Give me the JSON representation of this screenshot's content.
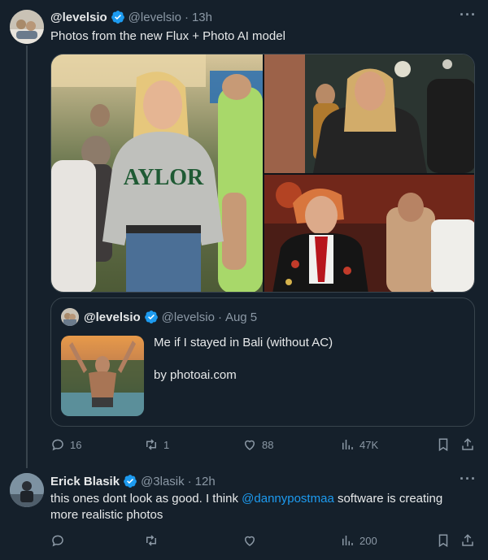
{
  "tweet": {
    "display_name": "@levelsio",
    "handle": "@levelsio",
    "separator": "·",
    "time": "13h",
    "text": "Photos from the new Flux + Photo AI model",
    "hoodie_text": "AYLOR"
  },
  "quote": {
    "display_name": "@levelsio",
    "handle": "@levelsio",
    "separator": "·",
    "date": "Aug 5",
    "text_line1": "Me if I stayed in Bali (without AC)",
    "text_line2": "by photoai.com"
  },
  "tweet_actions": {
    "replies": "16",
    "retweets": "1",
    "likes": "88",
    "views": "47K"
  },
  "reply": {
    "display_name": "Erick Blasik",
    "handle": "@3lasik",
    "separator": "·",
    "time": "12h",
    "text_before": "this ones dont look as good. I think ",
    "mention": "@dannypostmaa",
    "text_after": " software is creating more realistic photos"
  },
  "reply_actions": {
    "views": "200"
  },
  "colors": {
    "background": "#15202b",
    "accent": "#1d9bf0",
    "muted": "#8b98a5",
    "border": "#38444d"
  }
}
